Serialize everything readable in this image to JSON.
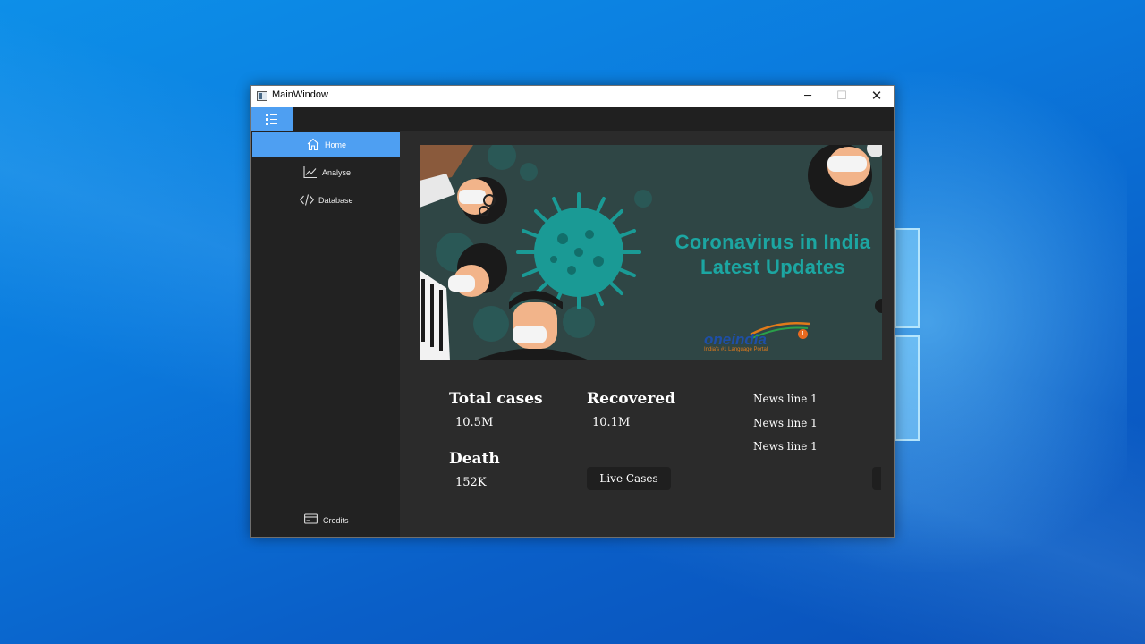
{
  "window": {
    "title": "MainWindow"
  },
  "titlebar": {
    "minimize": "─",
    "maximize": "☐",
    "close": "✕"
  },
  "sidebar": {
    "items": [
      {
        "label": "Home",
        "icon": "home-icon",
        "active": true
      },
      {
        "label": "Analyse",
        "icon": "chart-line-icon",
        "active": false
      },
      {
        "label": "Database",
        "icon": "code-icon",
        "active": false
      }
    ],
    "credits": {
      "label": "Credits",
      "icon": "card-icon"
    }
  },
  "banner": {
    "title_line1": "Coronavirus in India",
    "title_line2": "Latest Updates",
    "brand": "oneindia",
    "brand_badge": "1",
    "brand_tagline": "India's #1 Language Portal"
  },
  "stats": {
    "total_cases": {
      "label": "Total cases",
      "value": "10.5M"
    },
    "recovered": {
      "label": "Recovered",
      "value": "10.1M"
    },
    "death": {
      "label": "Death",
      "value": "152K"
    }
  },
  "live_cases_button": "Live Cases",
  "news": [
    "News line 1",
    "News line 1",
    "News line 1"
  ],
  "colors": {
    "accent": "#4e9ff2",
    "sidebar_bg": "#222222",
    "content_bg": "#2b2b2b",
    "banner_teal": "#1ca6a2"
  }
}
